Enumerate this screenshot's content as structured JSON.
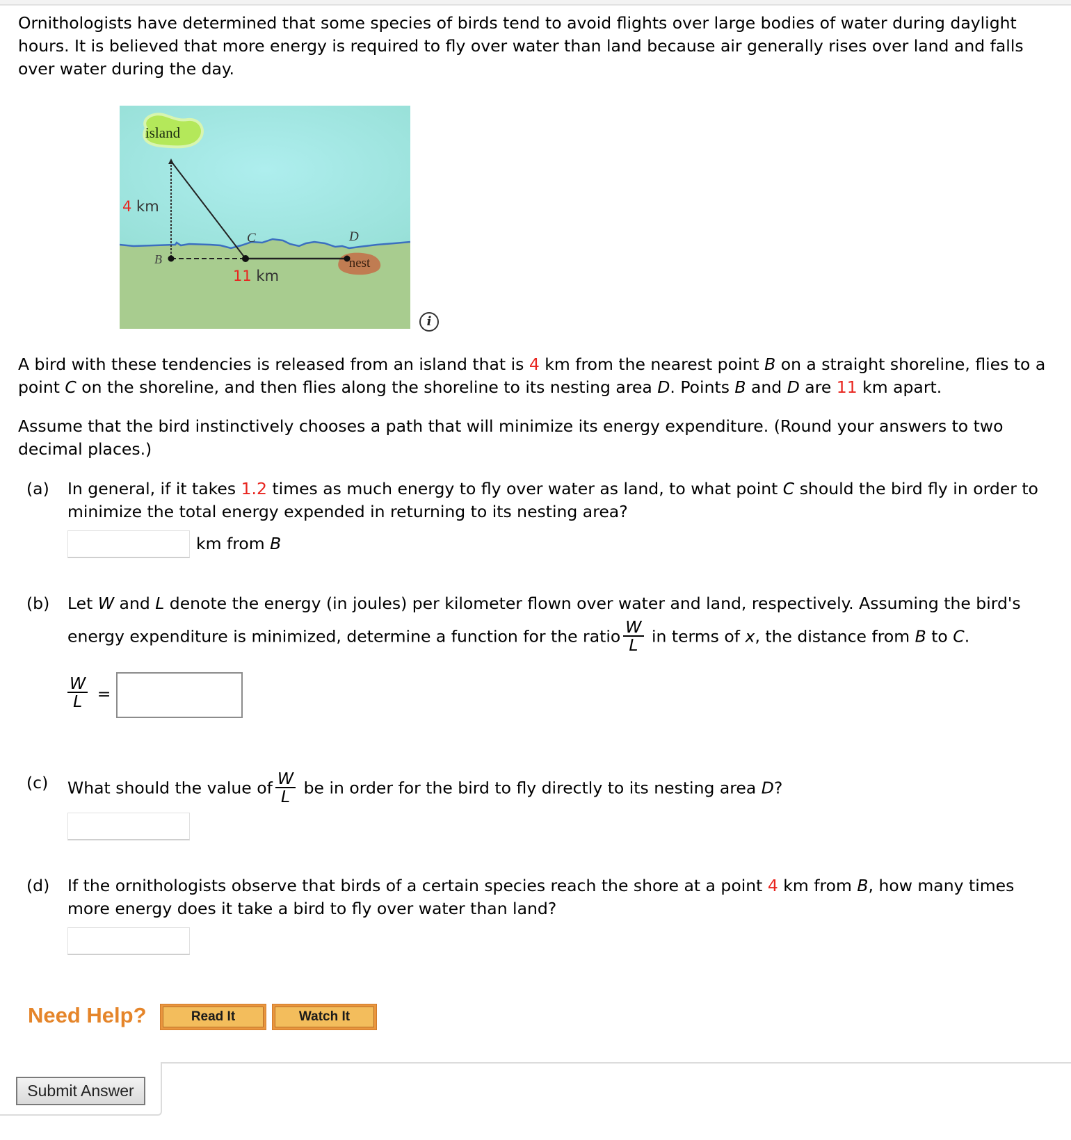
{
  "intro": {
    "text": "Ornithologists have determined that some species of birds tend to avoid flights over large bodies of water during daylight hours. It is believed that more energy is required to fly over water than land because air generally rises over land and falls over water during the day."
  },
  "figure": {
    "island_label": "island",
    "nest_label": "nest",
    "point_b": "B",
    "point_c": "C",
    "point_d": "D",
    "vertical_distance_value": "4",
    "vertical_distance_unit": " km",
    "horizontal_distance_value": "11",
    "horizontal_distance_unit": " km",
    "colors": {
      "water": "#a6e6e4",
      "land": "#a8cc8f",
      "island": "#b4e85a",
      "nest": "#c07c52",
      "shoreline": "#3b6fc0",
      "highlight": "#e8251f"
    },
    "info_icon": "info-icon"
  },
  "problem": {
    "p1_a": "A bird with these tendencies is released from an island that is ",
    "island_distance": "4",
    "p1_b": " km from the nearest point ",
    "p1_B": "B",
    "p1_c": " on a straight shoreline, flies to a point ",
    "p1_C": "C",
    "p1_d": " on the shoreline, and then flies along the shoreline to its nesting area ",
    "p1_D": "D",
    "p1_e": ". Points ",
    "p1_B2": "B",
    "p1_f": " and ",
    "p1_D2": "D",
    "p1_g": " are ",
    "bd_distance": "11",
    "p1_h": " km apart.",
    "p2": "Assume that the bird instinctively chooses a path that will minimize its energy expenditure. (Round your answers to two decimal places.)"
  },
  "parts": {
    "a": {
      "label": "(a)",
      "t1": "In general, if it takes ",
      "ratio": "1.2",
      "t2": " times as much energy to fly over water as land, to what point ",
      "C": "C",
      "t3": " should the bird fly in order to minimize the total energy expended in returning to its nesting area?",
      "answer_value": "",
      "unit_a": "km from ",
      "unit_b": "B"
    },
    "b": {
      "label": "(b)",
      "t1": "Let ",
      "W": "W",
      "t2": " and ",
      "L": "L",
      "t3": " denote the energy (in joules) per kilometer flown over water and land, respectively. Assuming the bird's energy expenditure is minimized, determine a function for the ratio",
      "frac_num": "W",
      "frac_den": "L",
      "t4": " in terms of ",
      "x": "x",
      "t5": ", the distance from ",
      "B": "B",
      "t6": " to ",
      "C": "C",
      "t7": ".",
      "equals": "=",
      "answer_value": ""
    },
    "c": {
      "label": "(c)",
      "t1": "What should the value of",
      "frac_num": "W",
      "frac_den": "L",
      "t2": " be in order for the bird to fly directly to its nesting area ",
      "D": "D",
      "t3": "?",
      "answer_value": ""
    },
    "d": {
      "label": "(d)",
      "t1": "If the ornithologists observe that birds of a certain species reach the shore at a point ",
      "distance": "4",
      "t2": " km from ",
      "B": "B",
      "t3": ", how many times more energy does it take a bird to fly over water than land?",
      "answer_value": ""
    }
  },
  "help": {
    "need_help": "Need Help?",
    "read_it": "Read It",
    "watch_it": "Watch It",
    "color": "#e5852a"
  },
  "submit": {
    "label": "Submit Answer"
  }
}
